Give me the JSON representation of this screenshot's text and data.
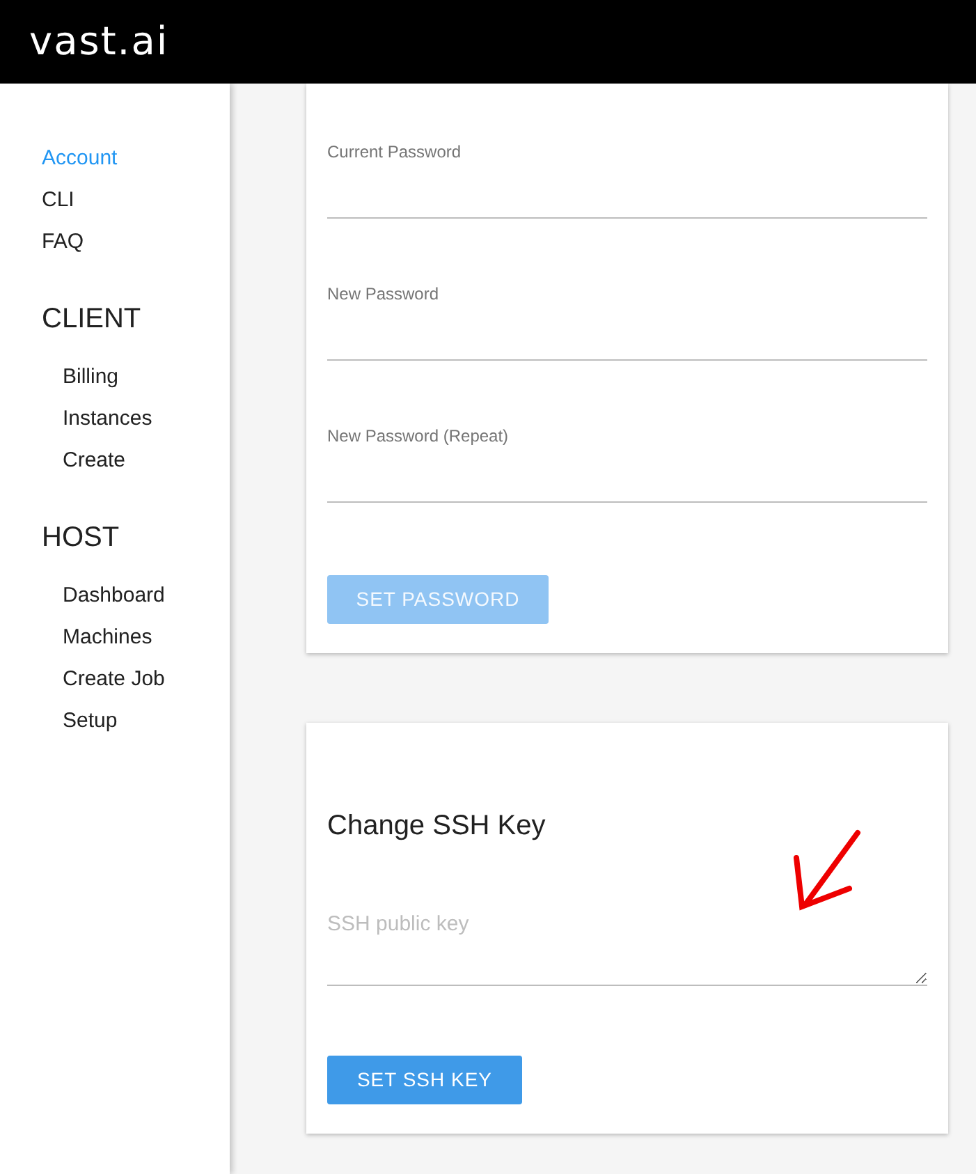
{
  "header": {
    "logo": "vast.ai"
  },
  "sidebar": {
    "items": [
      {
        "label": "Account",
        "selected": true
      },
      {
        "label": "CLI",
        "selected": false
      },
      {
        "label": "FAQ",
        "selected": false
      }
    ],
    "sections": [
      {
        "title": "CLIENT",
        "items": [
          {
            "label": "Billing",
            "selected": false
          },
          {
            "label": "Instances",
            "selected": false
          },
          {
            "label": "Create",
            "selected": false
          }
        ]
      },
      {
        "title": "HOST",
        "items": [
          {
            "label": "Dashboard",
            "selected": false
          },
          {
            "label": "Machines",
            "selected": false
          },
          {
            "label": "Create Job",
            "selected": false
          },
          {
            "label": "Setup",
            "selected": false
          }
        ]
      }
    ]
  },
  "password_card": {
    "fields": [
      {
        "label": "Current Password"
      },
      {
        "label": "New Password"
      },
      {
        "label": "New Password (Repeat)"
      }
    ],
    "button": {
      "label": "SET PASSWORD",
      "disabled": true
    }
  },
  "ssh_card": {
    "title": "Change SSH Key",
    "field": {
      "placeholder": "SSH public key"
    },
    "button": {
      "label": "SET SSH KEY",
      "disabled": false
    }
  }
}
